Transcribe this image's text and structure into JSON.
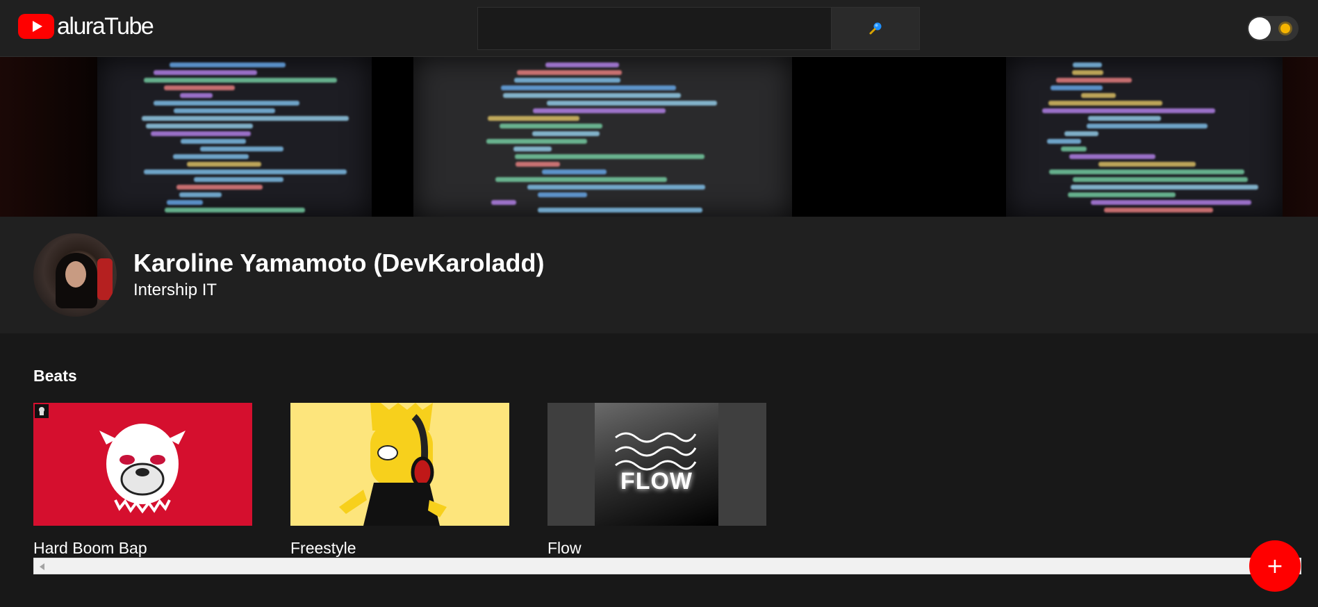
{
  "header": {
    "logo_text": "aluraTube",
    "search": {
      "value": "",
      "placeholder": ""
    },
    "search_icon": "magnifier-icon",
    "theme_toggle_icon": "sun-icon"
  },
  "profile": {
    "name": "Karoline Yamamoto (DevKaroladd)",
    "role": "Intership IT"
  },
  "playlist": {
    "title": "Beats",
    "videos": [
      {
        "title": "Hard Boom Bap"
      },
      {
        "title": "Freestyle"
      },
      {
        "title": "Flow",
        "thumb_text": "FLOW"
      }
    ]
  },
  "fab": {
    "label": "+"
  },
  "colors": {
    "brand": "#ff0000",
    "background": "#181818",
    "surface": "#202020",
    "card1": "#d50f2e",
    "card2": "#fde57c"
  }
}
